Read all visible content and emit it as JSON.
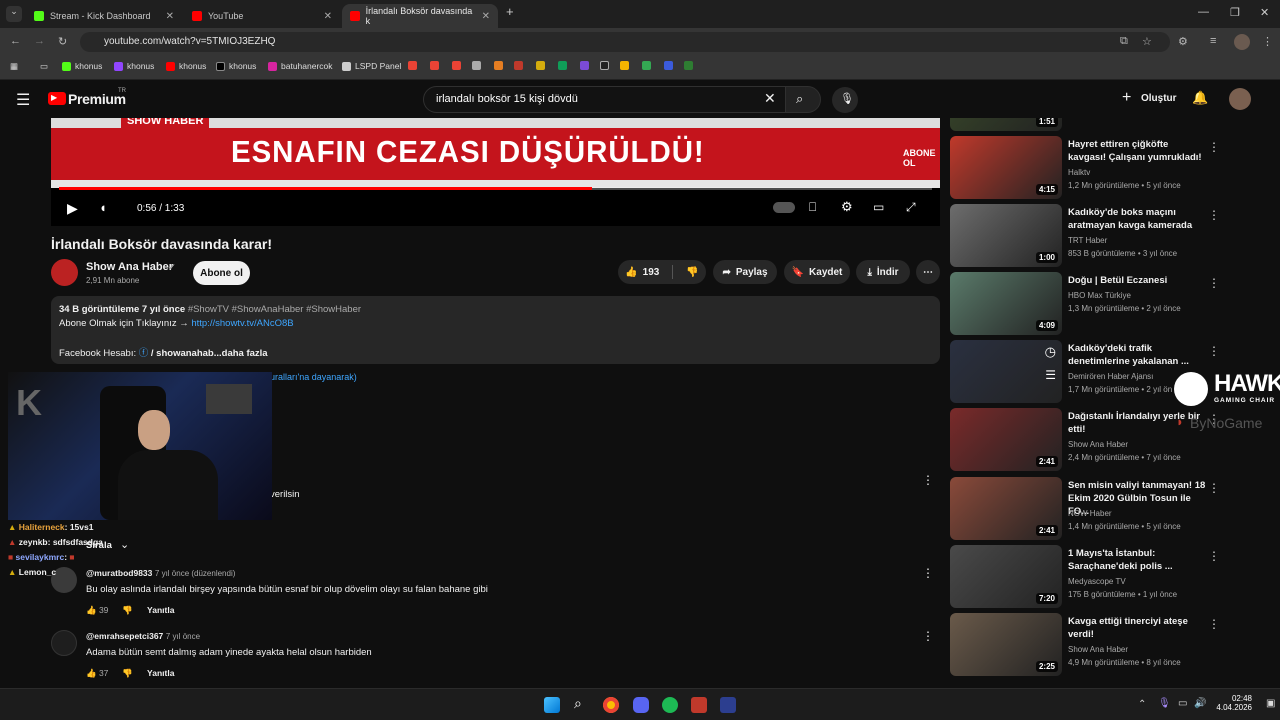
{
  "browser": {
    "tabs": [
      {
        "label": "Stream - Kick Dashboard",
        "color": "#53fc18"
      },
      {
        "label": "YouTube",
        "color": "#ff0000"
      },
      {
        "label": "İrlandalı Boksör davasında k",
        "color": "#ff0000"
      }
    ],
    "url": "youtube.com/watch?v=5TMIOJ3EZHQ",
    "bookmarks": [
      "khonus",
      "khonus",
      "khonus",
      "khonus",
      "batuhanercok",
      "LSPD Panel"
    ]
  },
  "yt": {
    "logo": "Premium",
    "logo_sup": "TR",
    "search_value": "irlandalı boksör 15 kişi dövdü",
    "create_label": "Oluştur"
  },
  "video": {
    "banner_text": "ESNAFIN CEZASI DÜŞÜRÜLDÜ!",
    "show_haber": "SHOW HABER",
    "abone_ol_overlay": "ABONE OL",
    "time": "0:56 / 1:33",
    "progress_fraction": 0.61,
    "title": "İrlandalı Boksör davasında karar!"
  },
  "channel": {
    "name": "Show Ana Haber",
    "subs": "2,91 Mn abone",
    "subscribe_label": "Abone ol"
  },
  "actions": {
    "likes": "193",
    "share": "Paylaş",
    "save": "Kaydet",
    "download": "İndir"
  },
  "description": {
    "meta": "34 B görüntüleme  7 yıl önce",
    "tags": "#ShowTV #ShowAnaHaber #ShowHaber",
    "line1": "Abone Olmak için Tıklayınız →",
    "link": "http://showtv.tv/ANcO8B",
    "fb": "Facebook Hesabı:",
    "fb_handle": "/ showanahab",
    "more": "...daha fazla",
    "rules_partial": "uralları'na dayanarak)",
    "verilsin": "verilsin",
    "sort": "Sırala"
  },
  "comments": [
    {
      "user": "@muratbod9833",
      "time": "7 yıl önce (düzenlendi)",
      "text": "Bu olay aslında irlandalı birşey yapsında bütün esnaf bir olup dövelim olayı su falan bahane gibi",
      "likes": "39",
      "reply": "Yanıtla"
    },
    {
      "user": "@emrahsepetci367",
      "time": "7 yıl önce",
      "text": "Adama bütün semt dalmış adam yinede ayakta helal olsun harbiden",
      "likes": "37",
      "reply": "Yanıtla"
    }
  ],
  "chat": [
    {
      "user": "Haliterneck",
      "msg": ": 15vs1",
      "color": "#e8a33d"
    },
    {
      "user": "zeynkb",
      "msg": ": sdfsdfasdga",
      "color": "#ffffff"
    },
    {
      "user": "sevilaykmrc",
      "msg": ":",
      "color": "#8fa8ff"
    },
    {
      "user": "Lemon_c",
      "msg": "",
      "color": "#ffffff"
    }
  ],
  "watermark": {
    "brand": "HAWK",
    "sub": "GAMING CHAIR",
    "partner": "ByNoGame"
  },
  "sidebar": [
    {
      "title": "",
      "channel": "",
      "meta": "",
      "dur": "1:51",
      "color": "#3a4a2a"
    },
    {
      "title": "Hayret ettiren çiğköfte kavgası! Çalışanı yumrukladı!",
      "channel": "Halktv",
      "meta": "1,2 Mn görüntüleme • 5 yıl önce",
      "dur": "4:15",
      "color": "#c0392b"
    },
    {
      "title": "Kadıköy'de boks maçını aratmayan kavga kamerada",
      "channel": "TRT Haber",
      "meta": "853 B görüntüleme • 3 yıl önce",
      "dur": "1:00",
      "color": "#6d6d6d"
    },
    {
      "title": "Doğu | Betül Eczanesi",
      "channel": "HBO Max Türkiye",
      "meta": "1,3 Mn görüntüleme • 2 yıl önce",
      "dur": "4:09",
      "color": "#5a7a6a"
    },
    {
      "title": "Kadıköy'deki trafik denetimlerine yakalanan ...",
      "channel": "Demirören Haber Ajansı",
      "meta": "1,7 Mn görüntüleme • 2 yıl ön",
      "dur": "",
      "color": "#2a3040"
    },
    {
      "title": "Dağıstanlı İrlandalıyı yerle bir etti!",
      "channel": "Show Ana Haber",
      "meta": "2,4 Mn görüntüleme • 7 yıl önce",
      "dur": "2:41",
      "color": "#7a2a2a"
    },
    {
      "title": "Sen misin valiyi tanımayan! 18 Ekim 2020 Gülbin Tosun ile FO...",
      "channel": "NOW Haber",
      "meta": "1,4 Mn görüntüleme • 5 yıl önce",
      "dur": "2:41",
      "color": "#8a4a3a"
    },
    {
      "title": "1 Mayıs'ta İstanbul: Saraçhane'deki polis ...",
      "channel": "Medyascope TV",
      "meta": "175 B görüntüleme • 1 yıl önce",
      "dur": "7:20",
      "color": "#4a4a4a"
    },
    {
      "title": "Kavga ettiği tinerciyi ateşe verdi!",
      "channel": "Show Ana Haber",
      "meta": "4,9 Mn görüntüleme • 8 yıl önce",
      "dur": "2:25",
      "color": "#6a5a4a"
    }
  ],
  "taskbar": {
    "time": "02:48",
    "date": "4.04.2026"
  }
}
